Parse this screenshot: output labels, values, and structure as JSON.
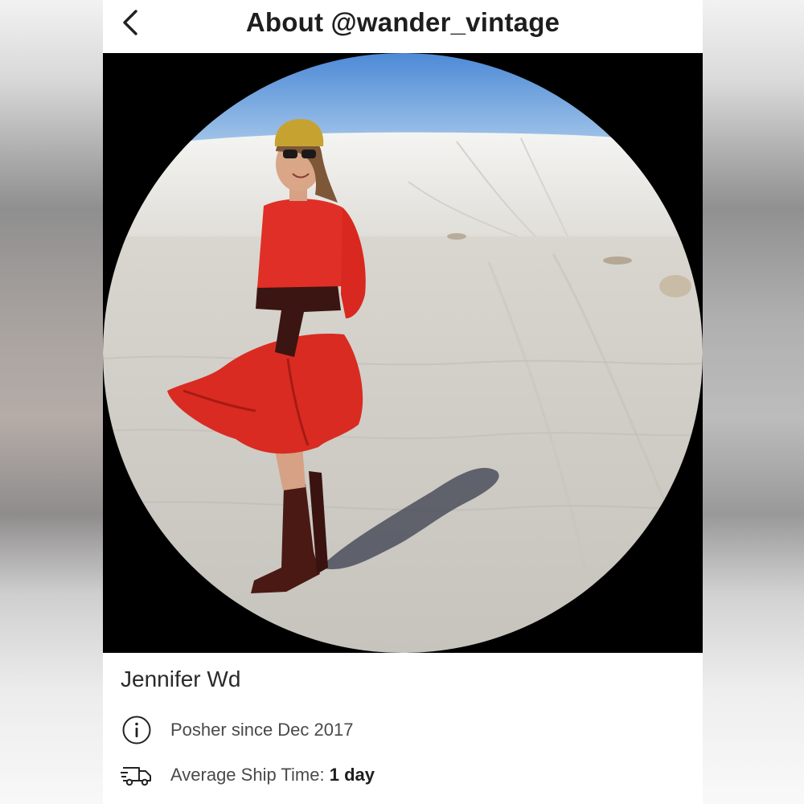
{
  "header": {
    "title": "About @wander_vintage",
    "back_icon": "chevron-left-icon"
  },
  "profile": {
    "display_name": "Jennifer Wd",
    "photo": "profile-photo"
  },
  "details": {
    "posher_since": {
      "icon": "info-icon",
      "text": "Posher since Dec 2017"
    },
    "ship_time": {
      "icon": "truck-icon",
      "label": "Average Ship Time:",
      "value": "1 day"
    }
  },
  "colors": {
    "text_dark": "#1e1e1e",
    "text_muted": "#4a4a4a",
    "background": "#ffffff",
    "photo_frame": "#000000"
  }
}
